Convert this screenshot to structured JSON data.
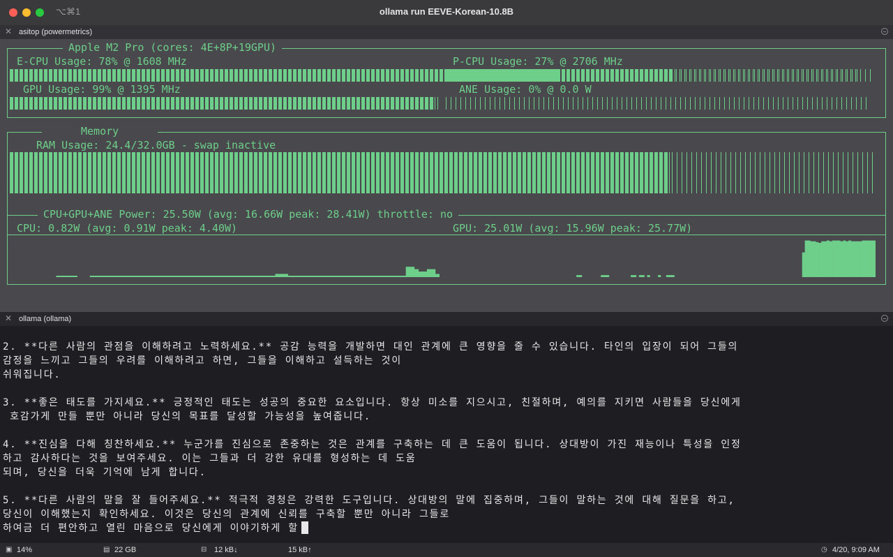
{
  "window": {
    "shortcut": "⌥⌘1",
    "title": "ollama run EEVE-Korean-10.8B"
  },
  "panes": {
    "top_label": "asitop (powermetrics)",
    "bottom_label": "ollama (ollama)"
  },
  "asitop": {
    "processor_title": "Apple M2 Pro (cores: 4E+8P+19GPU)",
    "ecpu": {
      "label": "E-CPU Usage: 78% @ 1608 MHz",
      "usage": 0.78
    },
    "pcpu": {
      "label": "P-CPU Usage: 27% @ 2706 MHz",
      "usage": 0.27
    },
    "gpu": {
      "label": "GPU Usage: 99% @ 1395 MHz",
      "usage": 0.99
    },
    "ane": {
      "label": "ANE Usage: 0% @ 0.0 W",
      "usage": 0.0
    },
    "memory_title": "Memory",
    "ram": {
      "label": "RAM Usage: 24.4/32.0GB - swap inactive",
      "usage": 0.7625
    },
    "power_title": "CPU+GPU+ANE Power: 25.50W (avg: 16.66W peak: 28.41W) throttle: no",
    "cpu_power_label": "CPU: 0.82W (avg: 0.91W peak: 4.40W)",
    "gpu_power_label": "GPU: 25.01W (avg: 15.96W peak: 25.77W)",
    "cpu_power_history": [
      0,
      0,
      0,
      0,
      0,
      0,
      0,
      0,
      0,
      0,
      0,
      0.01,
      0.01,
      0.01,
      0.01,
      0.01,
      0,
      0,
      0,
      0.01,
      0.01,
      0.01,
      0.01,
      0.01,
      0.01,
      0.01,
      0.01,
      0.01,
      0.01,
      0.01,
      0.01,
      0.01,
      0.01,
      0.01,
      0.01,
      0.01,
      0.01,
      0.01,
      0.01,
      0.01,
      0.01,
      0.01,
      0.01,
      0.01,
      0.01,
      0.01,
      0.01,
      0.01,
      0.01,
      0.01,
      0.01,
      0.01,
      0.01,
      0.01,
      0.01,
      0.01,
      0.01,
      0.01,
      0.01,
      0.01,
      0.01,
      0.01,
      0.01,
      0.08,
      0.08,
      0.08,
      0.01,
      0.01,
      0.01,
      0.01,
      0.01,
      0.01,
      0.01,
      0.01,
      0.01,
      0.01,
      0.01,
      0.01,
      0.01,
      0.01,
      0.01,
      0.01,
      0.01,
      0.01,
      0.01,
      0.01,
      0.01,
      0.01,
      0.01,
      0.01,
      0.01,
      0.01,
      0.01,
      0.01,
      0.26,
      0.26,
      0.2,
      0.14,
      0.14,
      0.2,
      0.2,
      0.08
    ],
    "gpu_power_history": [
      0,
      0,
      0,
      0,
      0,
      0,
      0,
      0,
      0,
      0,
      0,
      0,
      0,
      0,
      0,
      0,
      0,
      0,
      0,
      0,
      0,
      0,
      0,
      0,
      0,
      0,
      0,
      0,
      0,
      0,
      0,
      0,
      0,
      0,
      0,
      0,
      0,
      0,
      0,
      0,
      0,
      0,
      0,
      0,
      0,
      0,
      0,
      0,
      0.05,
      0.05,
      0,
      0,
      0,
      0,
      0,
      0,
      0,
      0.05,
      0.05,
      0.05,
      0,
      0,
      0,
      0,
      0,
      0,
      0,
      0,
      0.05,
      0.05,
      0,
      0.05,
      0.05,
      0,
      0.05,
      0,
      0,
      0,
      0.05,
      0,
      0,
      0.05,
      0.05,
      0.05,
      0,
      0,
      0,
      0,
      0,
      0,
      0,
      0,
      0,
      0,
      0,
      0,
      0,
      0,
      0,
      0,
      0,
      0,
      0,
      0,
      0,
      0,
      0,
      0,
      0,
      0,
      0,
      0,
      0,
      0,
      0,
      0,
      0,
      0,
      0,
      0,
      0,
      0,
      0,
      0,
      0,
      0,
      0,
      0,
      0,
      0,
      0,
      0.62,
      0.92,
      0.92,
      0.9,
      0.9,
      0.88,
      0.86,
      0.9,
      0.9,
      0.92,
      0.9,
      0.92,
      0.92,
      0.92,
      0.9,
      0.92,
      0.9,
      0.92,
      0.9,
      0.9,
      0.9,
      0.9,
      0.92,
      0.92,
      0.92,
      0.92,
      0.92
    ]
  },
  "chat": {
    "lines": [
      "2. **다른 사람의 관점을 이해하려고 노력하세요.** 공감 능력을 개발하면 대인 관계에 큰 영향을 줄 수 있습니다. 타인의 입장이 되어 그들의",
      "감정을 느끼고 그들의 우려를 이해하려고 하면, 그들을 이해하고 설득하는 것이",
      "쉬워집니다.",
      "",
      "3. **좋은 태도를 가지세요.** 긍정적인 태도는 성공의 중요한 요소입니다. 항상 미소를 지으시고, 친절하며, 예의를 지키면 사람들을 당신에게",
      " 호감가게 만들 뿐만 아니라 당신의 목표를 달성할 가능성을 높여줍니다.",
      "",
      "4. **진심을 다해 칭찬하세요.** 누군가를 진심으로 존중하는 것은 관계를 구축하는 데 큰 도움이 됩니다. 상대방이 가진 재능이나 특성을 인정",
      "하고 감사하다는 것을 보여주세요. 이는 그들과 더 강한 유대를 형성하는 데 도움",
      "되며, 당신을 더욱 기억에 남게 합니다.",
      "",
      "5. **다른 사람의 말을 잘 들어주세요.** 적극적 경청은 강력한 도구입니다. 상대방의 말에 집중하며, 그들이 말하는 것에 대해 질문을 하고,",
      "당신이 이해했는지 확인하세요. 이것은 당신의 관계에 신뢰를 구축할 뿐만 아니라 그들로",
      "하여금 더 편안하고 열린 마음으로 당신에게 이야기하게 할"
    ]
  },
  "status": {
    "cpu": "14%",
    "mem": "22 GB",
    "net_down": "12 kB↓",
    "net_up": "15 kB↑",
    "datetime": "4/20, 9:09 AM"
  },
  "colors": {
    "accent": "#6ecf8a",
    "pane_bg": "#48484d",
    "terminal_bg": "#1e1e22"
  }
}
